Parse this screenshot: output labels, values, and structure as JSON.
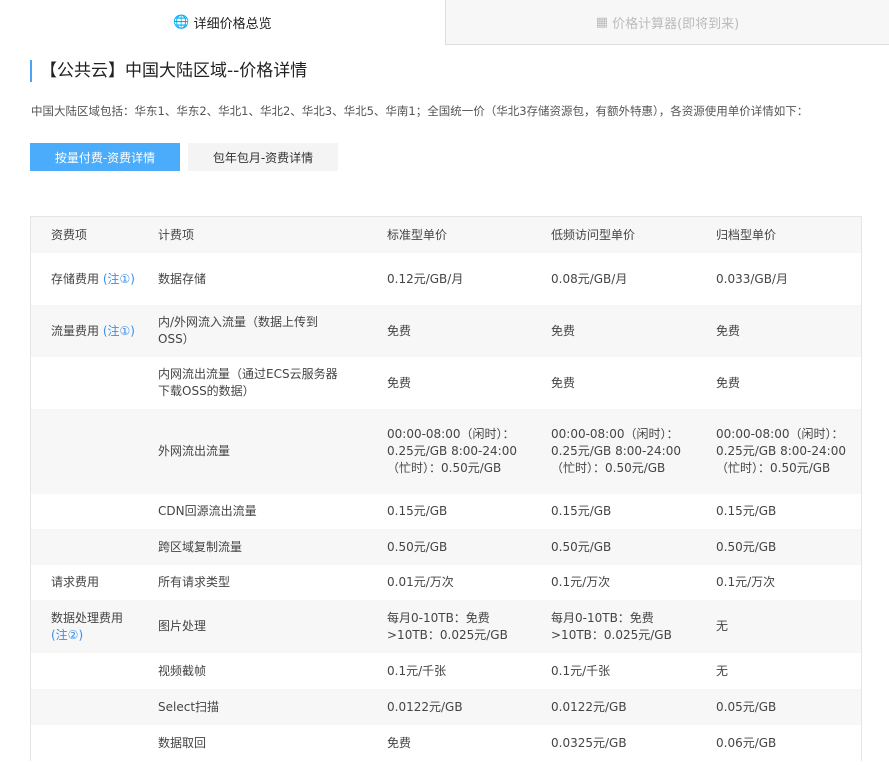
{
  "tabs": [
    {
      "label": "详细价格总览",
      "icon": "globe-icon"
    },
    {
      "label": "价格计算器(即将到来)",
      "icon": "calculator-icon"
    }
  ],
  "title": "【公共云】中国大陆区域--价格详情",
  "description": "中国大陆区域包括：华东1、华东2、华北1、华北2、华北3、华北5、华南1；全国统一价（华北3存储资源包，有额外特惠），各资源使用单价详情如下：",
  "buttons": [
    "按量付费-资费详情",
    "包年包月-资费详情"
  ],
  "table": {
    "headers": [
      "资费项",
      "计费项",
      "标准型单价",
      "低频访问型单价",
      "归档型单价"
    ],
    "rows": [
      {
        "cat": "存储费用",
        "note": "(注①)",
        "item": "数据存储",
        "std": "0.12元/GB/月",
        "ia": "0.08元/GB/月",
        "arc": "0.033/GB/月"
      },
      {
        "cat": "流量费用",
        "note": "(注①)",
        "item": "内/外网流入流量（数据上传到OSS）",
        "std": "免费",
        "ia": "免费",
        "arc": "免费"
      },
      {
        "cat": "",
        "note": "",
        "item": "内网流出流量（通过ECS云服务器下载OSS的数据）",
        "std": "免费",
        "ia": "免费",
        "arc": "免费"
      },
      {
        "cat": "",
        "note": "",
        "item": "外网流出流量",
        "std": "00:00-08:00（闲时）：0.25元/GB 8:00-24:00（忙时）：0.50元/GB",
        "ia": "00:00-08:00（闲时）：0.25元/GB 8:00-24:00（忙时）：0.50元/GB",
        "arc": "00:00-08:00（闲时）：0.25元/GB 8:00-24:00（忙时）：0.50元/GB"
      },
      {
        "cat": "",
        "note": "",
        "item": "CDN回源流出流量",
        "std": "0.15元/GB",
        "ia": "0.15元/GB",
        "arc": "0.15元/GB"
      },
      {
        "cat": "",
        "note": "",
        "item": "跨区域复制流量",
        "std": "0.50元/GB",
        "ia": "0.50元/GB",
        "arc": "0.50元/GB"
      },
      {
        "cat": "请求费用",
        "note": "",
        "item": "所有请求类型",
        "std": "0.01元/万次",
        "ia": "0.1元/万次",
        "arc": "0.1元/万次"
      },
      {
        "cat": "数据处理费用",
        "note": "(注②)",
        "item": "图片处理",
        "std": "每月0-10TB：免费 >10TB：0.025元/GB",
        "ia": "每月0-10TB：免费 >10TB：0.025元/GB",
        "arc": "无"
      },
      {
        "cat": "",
        "note": "",
        "item": "视频截帧",
        "std": "0.1元/千张",
        "ia": "0.1元/千张",
        "arc": "无"
      },
      {
        "cat": "",
        "note": "",
        "item": "Select扫描",
        "std": "0.0122元/GB",
        "ia": "0.0122元/GB",
        "arc": "0.05元/GB"
      },
      {
        "cat": "",
        "note": "",
        "item": "数据取回",
        "std": "免费",
        "ia": "0.0325元/GB",
        "arc": "0.06元/GB"
      }
    ]
  }
}
